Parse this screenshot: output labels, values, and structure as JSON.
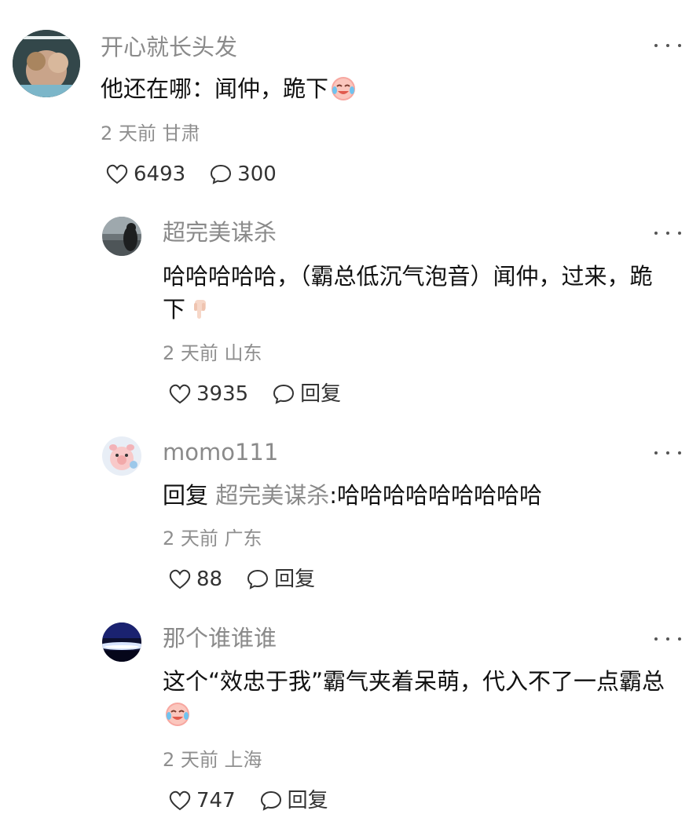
{
  "comments": [
    {
      "username": "开心就长头发",
      "text": "他还在哪：闻仲，跪下",
      "emoji": "crying-laughing-emoji",
      "time": "2 天前",
      "location": "甘肃",
      "likes": "6493",
      "replies": "300"
    },
    {
      "username": "超完美谋杀",
      "text": "哈哈哈哈哈，（霸总低沉气泡音）闻仲，过来，跪下",
      "emoji": "pointing-down-emoji",
      "time": "2 天前",
      "location": "山东",
      "likes": "3935",
      "replies": "回复"
    },
    {
      "username": "momo111",
      "reply_prefix": "回复",
      "mention": "超完美谋杀",
      "text": ":哈哈哈哈哈哈哈哈哈",
      "time": "2 天前",
      "location": "广东",
      "likes": "88",
      "replies": "回复"
    },
    {
      "username": "那个谁谁谁",
      "text": "这个“效忠于我”霸气夹着呆萌，代入不了一点霸总",
      "emoji": "crying-laughing-emoji",
      "time": "2 天前",
      "location": "上海",
      "likes": "747",
      "replies": "回复"
    }
  ],
  "icons": {
    "like": "heart-outline-icon",
    "reply": "speech-bubble-icon",
    "more": "more-dots-icon"
  }
}
